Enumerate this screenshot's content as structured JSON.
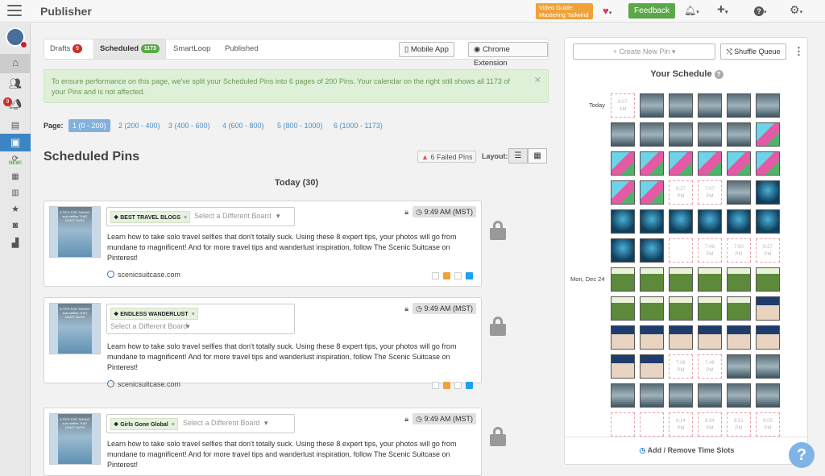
{
  "app": {
    "title": "Publisher"
  },
  "topbar": {
    "video_guide_line1": "Video Guide:",
    "video_guide_line2": "Mastering Tailwind",
    "feedback_label": "Feedback"
  },
  "sidebar": {
    "new_label": "NEW!",
    "notif_count": "9"
  },
  "tabs": [
    {
      "label": "Drafts",
      "count": "9",
      "color": "#c9302c"
    },
    {
      "label": "Scheduled",
      "count": "1173",
      "color": "#5aa849"
    },
    {
      "label": "SmartLoop"
    },
    {
      "label": "Published"
    }
  ],
  "toolbar": {
    "mobile_app": "Mobile App",
    "chrome_ext": "Chrome Extension"
  },
  "notice": {
    "text": "To ensure performance on this page, we've split your Scheduled Pins into 6 pages of 200 Pins. Your calendar on the right still shows all 1173 of your Pins and is not affected."
  },
  "pagination": {
    "label": "Page:",
    "pages": [
      "1 (0 - 200)",
      "2 (200 - 400)",
      "3 (400 - 600)",
      "4 (600 - 800)",
      "5 (800 - 1000)",
      "6 (1000 - 1173)"
    ]
  },
  "heading": "Scheduled Pins",
  "failed_pins": "6 Failed Pins",
  "layout_label": "Layout:",
  "day_heading": "Today (30)",
  "pins": [
    {
      "board": "BEST TRAVEL BLOGS",
      "board_placeholder": "Select a Different Board",
      "time": "9:49 AM (MST)",
      "description": "Learn how to take solo travel selfies that don't totally suck. Using these 8 expert tips, your photos will go from mundane to magnificent! And for more travel tips and wanderlust inspiration, follow The Scenic Suitcase on Pinterest!",
      "url": "scenicsuitcase.com",
      "thumb_text": "8 TIPS FOR TAKING solo selfies THAT DON'T SUCK"
    },
    {
      "board": "ENDLESS WANDERLUST",
      "board_placeholder": "Select a Different Board",
      "time": "9:49 AM (MST)",
      "description": "Learn how to take solo travel selfies that don't totally suck. Using these 8 expert tips, your photos will go from mundane to magnificent! And for more travel tips and wanderlust inspiration, follow The Scenic Suitcase on Pinterest!",
      "url": "scenicsuitcase.com",
      "thumb_text": "8 TIPS FOR TAKING solo selfies THAT DON'T SUCK"
    },
    {
      "board": "Girls Gone Global",
      "board_placeholder": "Select a Different Board",
      "time": "9:49 AM (MST)",
      "description": "Learn how to take solo travel selfies that don't totally suck. Using these 8 expert tips, your photos will go from mundane to magnificent! And for more travel tips and wanderlust inspiration, follow The Scenic Suitcase on Pinterest!",
      "url": "",
      "thumb_text": "8 TIPS FOR TAKING solo selfies THAT DON'T SUCK"
    }
  ],
  "schedule": {
    "create_pin": "Create New Pin",
    "shuffle": "Shuffle Queue",
    "title": "Your Schedule",
    "row_labels": [
      {
        "label": "Today",
        "row": 0
      },
      {
        "label": "Mon, Dec 24",
        "row": 6
      }
    ],
    "rows": [
      [
        "e:6:07 AM",
        "waterfall",
        "waterfall",
        "waterfall",
        "waterfall",
        "waterfall"
      ],
      [
        "waterfall",
        "waterfall",
        "waterfall",
        "waterfall",
        "waterfall",
        "pink"
      ],
      [
        "pink",
        "pink",
        "pink",
        "pink",
        "pink",
        "pink"
      ],
      [
        "pink",
        "pink",
        "e:6:27 PM",
        "e:7:07 PM",
        "waterfall",
        "blue"
      ],
      [
        "blue",
        "blue",
        "blue",
        "blue",
        "blue",
        "blue"
      ],
      [
        "blue",
        "blue",
        "e",
        "e:7:49 PM",
        "e:7:50 PM",
        "e:8:27 PM"
      ],
      [
        "green",
        "green",
        "green",
        "green",
        "green",
        "green"
      ],
      [
        "green",
        "green",
        "green",
        "green",
        "green",
        "sign"
      ],
      [
        "sign",
        "sign",
        "sign",
        "sign",
        "sign",
        "sign"
      ],
      [
        "sign",
        "sign",
        "e:7:06 PM",
        "e:7:46 PM",
        "waterfall",
        "waterfall"
      ],
      [
        "waterfall",
        "waterfall",
        "waterfall",
        "waterfall",
        "waterfall",
        "waterfall"
      ],
      [
        "e",
        "e",
        "e:8:14 PM",
        "e:8:34 PM",
        "e:8:51 PM",
        "e:8:05 PM"
      ]
    ],
    "add_remove": "Add / Remove Time Slots"
  },
  "help_label": "?"
}
